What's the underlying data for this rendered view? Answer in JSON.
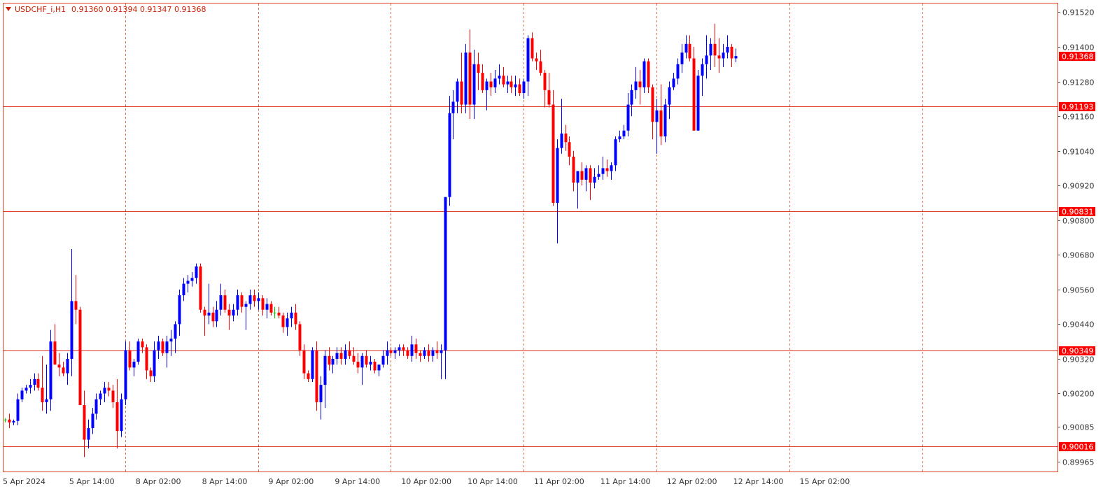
{
  "header": {
    "symbol_timeframe": "USDCHF_i,H1",
    "ohlc": "0.91360 0.91394 0.91347 0.91368"
  },
  "colors": {
    "bull": "#0000ff",
    "bear": "#ff0000",
    "neutral": "#00cc00",
    "grid_vertical": "#e0704a",
    "level_line": "#e03020",
    "level_label_bg": "#ff0000",
    "frame": "#e04020",
    "axis_text": "#333333"
  },
  "chart_data": {
    "type": "candlestick",
    "symbol": "USDCHF_i",
    "timeframe": "H1",
    "ylim": [
      0.8993,
      0.9155
    ],
    "price_ticks": [
      "0.91520",
      "0.91400",
      "0.91280",
      "0.91160",
      "0.91040",
      "0.90920",
      "0.90800",
      "0.90680",
      "0.90560",
      "0.90440",
      "0.90320",
      "0.90200",
      "0.90085",
      "0.89965"
    ],
    "time_labels": [
      {
        "bar": 0,
        "text": "5 Apr 2024"
      },
      {
        "bar": 16,
        "text": "5 Apr 14:00"
      },
      {
        "bar": 32,
        "text": "8 Apr 02:00"
      },
      {
        "bar": 48,
        "text": "8 Apr 14:00"
      },
      {
        "bar": 64,
        "text": "9 Apr 02:00"
      },
      {
        "bar": 80,
        "text": "9 Apr 14:00"
      },
      {
        "bar": 96,
        "text": "10 Apr 02:00"
      },
      {
        "bar": 112,
        "text": "10 Apr 14:00"
      },
      {
        "bar": 128,
        "text": "11 Apr 02:00"
      },
      {
        "bar": 144,
        "text": "11 Apr 14:00"
      },
      {
        "bar": 160,
        "text": "12 Apr 02:00"
      },
      {
        "bar": 176,
        "text": "12 Apr 14:00"
      },
      {
        "bar": 192,
        "text": "15 Apr 02:00"
      }
    ],
    "period_separators": [
      29,
      61,
      93,
      125,
      157,
      189,
      221
    ],
    "horizontal_levels": [
      0.91193,
      0.90831,
      0.90349,
      0.90016
    ],
    "horizontal_level_labels": [
      "0.91193",
      "0.90831",
      "0.90349",
      "0.90016"
    ],
    "current_price": 0.91368,
    "current_price_label": "0.91368",
    "candles": [
      [
        0.9011,
        0.90115,
        0.901,
        0.9011
      ],
      [
        0.9011,
        0.9013,
        0.9008,
        0.901
      ],
      [
        0.901,
        0.9011,
        0.9009,
        0.90105
      ],
      [
        0.90105,
        0.902,
        0.9009,
        0.9018
      ],
      [
        0.9018,
        0.9022,
        0.9017,
        0.9021
      ],
      [
        0.9021,
        0.9023,
        0.902,
        0.9022
      ],
      [
        0.9022,
        0.9025,
        0.902,
        0.9023
      ],
      [
        0.9023,
        0.9027,
        0.9021,
        0.9025
      ],
      [
        0.9025,
        0.9027,
        0.9021,
        0.9022
      ],
      [
        0.9022,
        0.9033,
        0.9014,
        0.9017
      ],
      [
        0.9017,
        0.903,
        0.9013,
        0.9018
      ],
      [
        0.9018,
        0.9042,
        0.9014,
        0.9038
      ],
      [
        0.9038,
        0.9044,
        0.903,
        0.903
      ],
      [
        0.903,
        0.9034,
        0.9026,
        0.9029
      ],
      [
        0.9029,
        0.9031,
        0.9026,
        0.9027
      ],
      [
        0.9027,
        0.9034,
        0.9023,
        0.9032
      ],
      [
        0.9032,
        0.907,
        0.9026,
        0.9052
      ],
      [
        0.9052,
        0.9061,
        0.9044,
        0.9049
      ],
      [
        0.9049,
        0.905,
        0.9016,
        0.9016
      ],
      [
        0.9016,
        0.9021,
        0.8998,
        0.9004
      ],
      [
        0.9004,
        0.9011,
        0.9001,
        0.9008
      ],
      [
        0.9008,
        0.9015,
        0.9006,
        0.9013
      ],
      [
        0.9013,
        0.902,
        0.9011,
        0.9018
      ],
      [
        0.9018,
        0.9021,
        0.9016,
        0.902
      ],
      [
        0.902,
        0.9024,
        0.9017,
        0.9022
      ],
      [
        0.9022,
        0.9024,
        0.9019,
        0.9021
      ],
      [
        0.9021,
        0.9023,
        0.9015,
        0.9017
      ],
      [
        0.9017,
        0.9025,
        0.9001,
        0.9007
      ],
      [
        0.9007,
        0.902,
        0.9005,
        0.9018
      ],
      [
        0.9018,
        0.9038,
        0.9016,
        0.9035
      ],
      [
        0.9035,
        0.9038,
        0.9028,
        0.9029
      ],
      [
        0.9029,
        0.9032,
        0.9026,
        0.9031
      ],
      [
        0.9031,
        0.9039,
        0.903,
        0.9038
      ],
      [
        0.9038,
        0.9039,
        0.9034,
        0.9036
      ],
      [
        0.9036,
        0.9037,
        0.9025,
        0.9028
      ],
      [
        0.9028,
        0.9029,
        0.9024,
        0.9026
      ],
      [
        0.9026,
        0.9038,
        0.9024,
        0.9035
      ],
      [
        0.9035,
        0.904,
        0.9032,
        0.9038
      ],
      [
        0.9038,
        0.9039,
        0.9033,
        0.9034
      ],
      [
        0.9034,
        0.904,
        0.9029,
        0.9038
      ],
      [
        0.9038,
        0.9042,
        0.9033,
        0.9039
      ],
      [
        0.9039,
        0.9045,
        0.9034,
        0.9044
      ],
      [
        0.9044,
        0.9056,
        0.904,
        0.9054
      ],
      [
        0.9054,
        0.906,
        0.9052,
        0.9058
      ],
      [
        0.9058,
        0.9061,
        0.9055,
        0.9059
      ],
      [
        0.9059,
        0.9062,
        0.9057,
        0.906
      ],
      [
        0.906,
        0.9065,
        0.9058,
        0.9064
      ],
      [
        0.9064,
        0.9065,
        0.9048,
        0.9049
      ],
      [
        0.9049,
        0.905,
        0.904,
        0.9047
      ],
      [
        0.9047,
        0.9058,
        0.9044,
        0.9048
      ],
      [
        0.9048,
        0.905,
        0.9043,
        0.9045
      ],
      [
        0.9045,
        0.9052,
        0.9043,
        0.9049
      ],
      [
        0.9049,
        0.9058,
        0.9047,
        0.9054
      ],
      [
        0.9054,
        0.9056,
        0.9048,
        0.9049
      ],
      [
        0.9049,
        0.9051,
        0.9042,
        0.9047
      ],
      [
        0.9047,
        0.9051,
        0.9045,
        0.9049
      ],
      [
        0.9049,
        0.9056,
        0.9047,
        0.9054
      ],
      [
        0.9054,
        0.9055,
        0.9048,
        0.905
      ],
      [
        0.905,
        0.9052,
        0.9042,
        0.9051
      ],
      [
        0.9051,
        0.9056,
        0.9049,
        0.9054
      ],
      [
        0.9054,
        0.9056,
        0.905,
        0.9052
      ],
      [
        0.9052,
        0.9055,
        0.9049,
        0.9053
      ],
      [
        0.9053,
        0.9054,
        0.9047,
        0.9049
      ],
      [
        0.9049,
        0.9053,
        0.9046,
        0.9051
      ],
      [
        0.9051,
        0.9052,
        0.9047,
        0.9048
      ],
      [
        0.9048,
        0.905,
        0.9046,
        0.9048
      ],
      [
        0.9048,
        0.905,
        0.9046,
        0.9047
      ],
      [
        0.9047,
        0.9048,
        0.9041,
        0.9043
      ],
      [
        0.9043,
        0.9048,
        0.904,
        0.9046
      ],
      [
        0.9046,
        0.905,
        0.9043,
        0.9048
      ],
      [
        0.9048,
        0.9051,
        0.9042,
        0.9044
      ],
      [
        0.9044,
        0.9045,
        0.9033,
        0.9035
      ],
      [
        0.9035,
        0.9037,
        0.9025,
        0.9027
      ],
      [
        0.9027,
        0.9028,
        0.9024,
        0.9025
      ],
      [
        0.9025,
        0.9036,
        0.9024,
        0.9035
      ],
      [
        0.9035,
        0.9038,
        0.9014,
        0.9017
      ],
      [
        0.9017,
        0.9026,
        0.9011,
        0.9023
      ],
      [
        0.9023,
        0.9035,
        0.9015,
        0.9033
      ],
      [
        0.9033,
        0.9036,
        0.9028,
        0.903
      ],
      [
        0.903,
        0.9033,
        0.9027,
        0.9032
      ],
      [
        0.9032,
        0.9036,
        0.903,
        0.9034
      ],
      [
        0.9034,
        0.9036,
        0.903,
        0.9032
      ],
      [
        0.9032,
        0.9037,
        0.903,
        0.9035
      ],
      [
        0.9035,
        0.9038,
        0.9032,
        0.9033
      ],
      [
        0.9033,
        0.9036,
        0.903,
        0.9031
      ],
      [
        0.9031,
        0.9034,
        0.9027,
        0.9029
      ],
      [
        0.9029,
        0.9034,
        0.9023,
        0.9033
      ],
      [
        0.9033,
        0.9035,
        0.9029,
        0.903
      ],
      [
        0.903,
        0.9033,
        0.9028,
        0.9031
      ],
      [
        0.9031,
        0.9032,
        0.9027,
        0.9028
      ],
      [
        0.9028,
        0.903,
        0.9026,
        0.903
      ],
      [
        0.903,
        0.9035,
        0.9029,
        0.9033
      ],
      [
        0.9033,
        0.9038,
        0.903,
        0.9035
      ],
      [
        0.9035,
        0.9036,
        0.9033,
        0.9034
      ],
      [
        0.9034,
        0.9036,
        0.9032,
        0.9035
      ],
      [
        0.9035,
        0.9037,
        0.9033,
        0.9036
      ],
      [
        0.9036,
        0.9037,
        0.9033,
        0.9035
      ],
      [
        0.9035,
        0.9036,
        0.9032,
        0.9033
      ],
      [
        0.9033,
        0.904,
        0.9031,
        0.9037
      ],
      [
        0.9037,
        0.9039,
        0.9032,
        0.9034
      ],
      [
        0.9034,
        0.9035,
        0.9031,
        0.9033
      ],
      [
        0.9033,
        0.9036,
        0.9032,
        0.9035
      ],
      [
        0.9035,
        0.9037,
        0.9031,
        0.9033
      ],
      [
        0.9033,
        0.9036,
        0.9031,
        0.9035
      ],
      [
        0.9035,
        0.9038,
        0.9032,
        0.9034
      ],
      [
        0.9034,
        0.9037,
        0.9025,
        0.9035
      ],
      [
        0.9035,
        0.9088,
        0.9025,
        0.9088
      ],
      [
        0.9088,
        0.9123,
        0.9085,
        0.9117
      ],
      [
        0.9117,
        0.9125,
        0.9108,
        0.9121
      ],
      [
        0.9121,
        0.9129,
        0.9117,
        0.9128
      ],
      [
        0.9128,
        0.9138,
        0.9117,
        0.912
      ],
      [
        0.912,
        0.9141,
        0.9117,
        0.9138
      ],
      [
        0.9138,
        0.9146,
        0.9115,
        0.912
      ],
      [
        0.912,
        0.9139,
        0.9115,
        0.9134
      ],
      [
        0.9134,
        0.9138,
        0.9125,
        0.9131
      ],
      [
        0.9131,
        0.9134,
        0.9124,
        0.9125
      ],
      [
        0.9125,
        0.9129,
        0.9118,
        0.9128
      ],
      [
        0.9128,
        0.9131,
        0.9123,
        0.9126
      ],
      [
        0.9126,
        0.9132,
        0.9124,
        0.9129
      ],
      [
        0.9129,
        0.9134,
        0.9127,
        0.913
      ],
      [
        0.913,
        0.9133,
        0.9126,
        0.9127
      ],
      [
        0.9127,
        0.913,
        0.9124,
        0.9128
      ],
      [
        0.9128,
        0.913,
        0.9124,
        0.9126
      ],
      [
        0.9126,
        0.913,
        0.9123,
        0.9127
      ],
      [
        0.9127,
        0.9129,
        0.9123,
        0.9124
      ],
      [
        0.9124,
        0.9129,
        0.9122,
        0.9128
      ],
      [
        0.9128,
        0.9144,
        0.9123,
        0.9143
      ],
      [
        0.9143,
        0.9145,
        0.9135,
        0.9136
      ],
      [
        0.9136,
        0.9138,
        0.9132,
        0.9135
      ],
      [
        0.9135,
        0.9139,
        0.913,
        0.9131
      ],
      [
        0.9131,
        0.9132,
        0.9119,
        0.9125
      ],
      [
        0.9125,
        0.9131,
        0.9119,
        0.912
      ],
      [
        0.912,
        0.9125,
        0.9085,
        0.9086
      ],
      [
        0.9086,
        0.9108,
        0.9072,
        0.9105
      ],
      [
        0.9105,
        0.9122,
        0.9103,
        0.911
      ],
      [
        0.911,
        0.9113,
        0.9104,
        0.9107
      ],
      [
        0.9107,
        0.9109,
        0.9099,
        0.9102
      ],
      [
        0.9102,
        0.9104,
        0.909,
        0.9093
      ],
      [
        0.9093,
        0.9097,
        0.9084,
        0.9097
      ],
      [
        0.9097,
        0.91,
        0.9092,
        0.9094
      ],
      [
        0.9094,
        0.9099,
        0.909,
        0.9098
      ],
      [
        0.9098,
        0.9099,
        0.9087,
        0.9093
      ],
      [
        0.9093,
        0.9098,
        0.9091,
        0.9095
      ],
      [
        0.9095,
        0.9099,
        0.9094,
        0.9096
      ],
      [
        0.9096,
        0.9102,
        0.9094,
        0.9098
      ],
      [
        0.9098,
        0.9101,
        0.9095,
        0.9097
      ],
      [
        0.9097,
        0.91,
        0.9094,
        0.9099
      ],
      [
        0.9099,
        0.9109,
        0.9097,
        0.9108
      ],
      [
        0.9108,
        0.9111,
        0.9107,
        0.9109
      ],
      [
        0.9109,
        0.9113,
        0.9108,
        0.9111
      ],
      [
        0.9111,
        0.9124,
        0.9109,
        0.912
      ],
      [
        0.912,
        0.9127,
        0.9116,
        0.9125
      ],
      [
        0.9125,
        0.9133,
        0.9122,
        0.9128
      ],
      [
        0.9128,
        0.9132,
        0.912,
        0.9126
      ],
      [
        0.9126,
        0.9136,
        0.9124,
        0.9135
      ],
      [
        0.9135,
        0.9136,
        0.9124,
        0.9126
      ],
      [
        0.9126,
        0.9127,
        0.9108,
        0.9114
      ],
      [
        0.9114,
        0.9122,
        0.9103,
        0.9118
      ],
      [
        0.9118,
        0.9127,
        0.9106,
        0.9109
      ],
      [
        0.9109,
        0.9122,
        0.9107,
        0.912
      ],
      [
        0.912,
        0.9128,
        0.9115,
        0.9126
      ],
      [
        0.9126,
        0.9131,
        0.9125,
        0.9129
      ],
      [
        0.9129,
        0.9136,
        0.9127,
        0.9134
      ],
      [
        0.9134,
        0.9141,
        0.9131,
        0.9138
      ],
      [
        0.9138,
        0.9144,
        0.9136,
        0.9141
      ],
      [
        0.9141,
        0.9144,
        0.9135,
        0.9136
      ],
      [
        0.9136,
        0.914,
        0.9111,
        0.9111
      ],
      [
        0.9111,
        0.9132,
        0.9111,
        0.913
      ],
      [
        0.913,
        0.9136,
        0.9123,
        0.9134
      ],
      [
        0.9134,
        0.9144,
        0.9129,
        0.9137
      ],
      [
        0.9137,
        0.9143,
        0.9132,
        0.9141
      ],
      [
        0.9141,
        0.9148,
        0.9133,
        0.9137
      ],
      [
        0.9137,
        0.9143,
        0.9131,
        0.9136
      ],
      [
        0.9136,
        0.9141,
        0.9133,
        0.9138
      ],
      [
        0.9138,
        0.9144,
        0.9136,
        0.914
      ],
      [
        0.914,
        0.9141,
        0.9133,
        0.9136
      ],
      [
        0.9136,
        0.91394,
        0.91347,
        0.91368
      ]
    ]
  }
}
